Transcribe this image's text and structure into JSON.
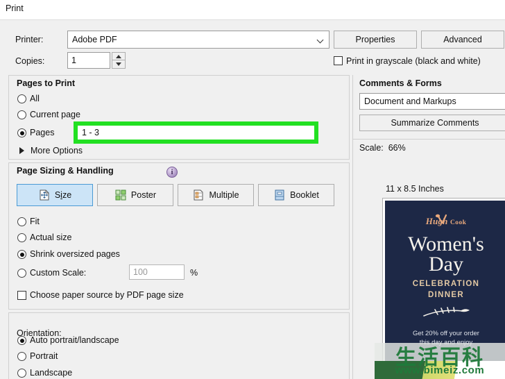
{
  "window": {
    "title": "Print"
  },
  "printer": {
    "label": "Printer:",
    "value": "Adobe PDF",
    "properties_label": "Properties",
    "advanced_label": "Advanced",
    "copies_label": "Copies:",
    "copies_value": "1",
    "grayscale_label": "Print in grayscale (black and white)"
  },
  "pages_to_print": {
    "header": "Pages to Print",
    "all_label": "All",
    "current_label": "Current page",
    "pages_label": "Pages",
    "pages_value": "1 - 3",
    "more_options_label": "More Options",
    "selected": "pages",
    "highlight_color": "#22e022"
  },
  "page_sizing": {
    "header": "Page Sizing & Handling",
    "info_glyph": "i",
    "buttons": [
      {
        "label_pre": "S",
        "label_accel": "i",
        "label_post": "ze",
        "name": "size"
      },
      {
        "label": "Poster",
        "name": "poster"
      },
      {
        "label": "Multiple",
        "name": "multiple"
      },
      {
        "label": "Booklet",
        "name": "booklet"
      }
    ],
    "selected_button": "size",
    "fit_label": "Fit",
    "actual_label": "Actual size",
    "shrink_label": "Shrink oversized pages",
    "custom_label": "Custom Scale:",
    "custom_value": "100",
    "percent_label": "%",
    "paper_source_label": "Choose paper source by PDF page size",
    "selected_scaling": "shrink"
  },
  "orientation": {
    "header": "Orientation:",
    "auto_label": "Auto portrait/landscape",
    "portrait_label": "Portrait",
    "landscape_label": "Landscape",
    "selected": "auto"
  },
  "comments_forms": {
    "header": "Comments & Forms",
    "value": "Document and Markups",
    "summarize_label": "Summarize Comments"
  },
  "preview": {
    "scale_label": "Scale:",
    "scale_value": "66%",
    "page_size": "11 x 8.5 Inches",
    "flyer": {
      "logo_main": "Hugh",
      "logo_sub": "Cook",
      "title_line1": "Women's",
      "title_line2": "Day",
      "sub_line1": "CELEBRATION",
      "sub_line2": "DINNER",
      "footer_line1": "Get 20% off your order",
      "footer_line2": "this day and enjoy",
      "bg_color": "#1d2846",
      "accent_color": "#e3c9a4"
    }
  },
  "watermark": {
    "cn_text": "生活百科",
    "url": "www.bimeiz.com"
  }
}
